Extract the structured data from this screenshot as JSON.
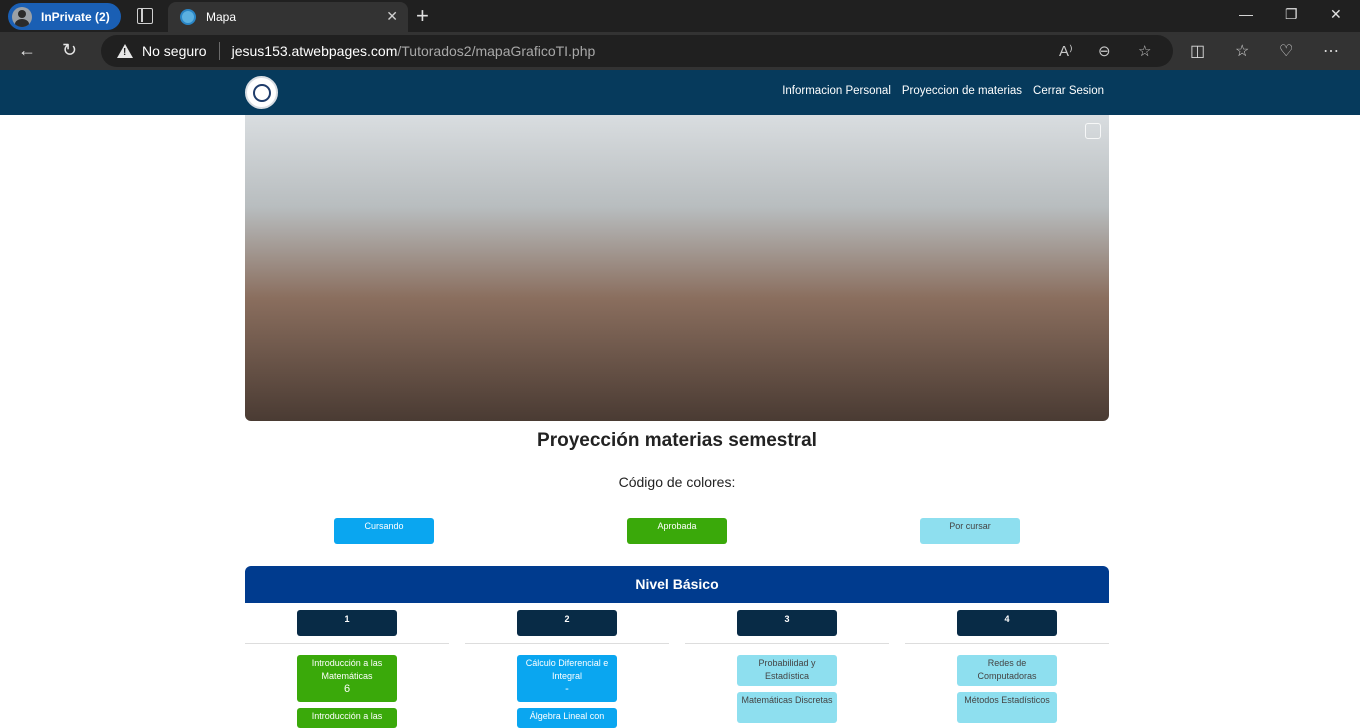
{
  "browser": {
    "profile_label": "InPrivate (2)",
    "tab_title": "Mapa",
    "security_label": "No seguro",
    "url_host": "jesus153.atwebpages.com",
    "url_path": "/Tutorados2/mapaGraficoTI.php"
  },
  "nav": {
    "links": [
      "Informacion Personal",
      "Proyeccion de materias",
      "Cerrar Sesion"
    ]
  },
  "main": {
    "title": "Proyección materias semestral",
    "legend_title": "Código de colores:",
    "legend": [
      {
        "label": "Cursando",
        "color": "#0aa6f0"
      },
      {
        "label": "Aprobada",
        "color": "#3aa90a"
      },
      {
        "label": "Por cursar",
        "color": "#8edfef"
      }
    ],
    "level_title": "Nivel Básico",
    "semesters": [
      "1",
      "2",
      "3",
      "4"
    ],
    "courses": {
      "s1": [
        {
          "name": "Introducción a las Matemáticas",
          "grade": "6",
          "status": "aprobada"
        },
        {
          "name": "Introducción a las",
          "status": "aprobada"
        }
      ],
      "s2": [
        {
          "name": "Cálculo Diferencial e Integral",
          "grade": "-",
          "status": "cursando"
        },
        {
          "name": "Álgebra Lineal con",
          "status": "cursando"
        }
      ],
      "s3": [
        {
          "name": "Probabilidad y Estadística",
          "status": "por cursar"
        },
        {
          "name": "Matemáticas Discretas",
          "status": "por cursar"
        }
      ],
      "s4": [
        {
          "name": "Redes de Computadoras",
          "status": "por cursar"
        },
        {
          "name": "Métodos Estadísticos",
          "status": "por cursar"
        }
      ]
    }
  }
}
